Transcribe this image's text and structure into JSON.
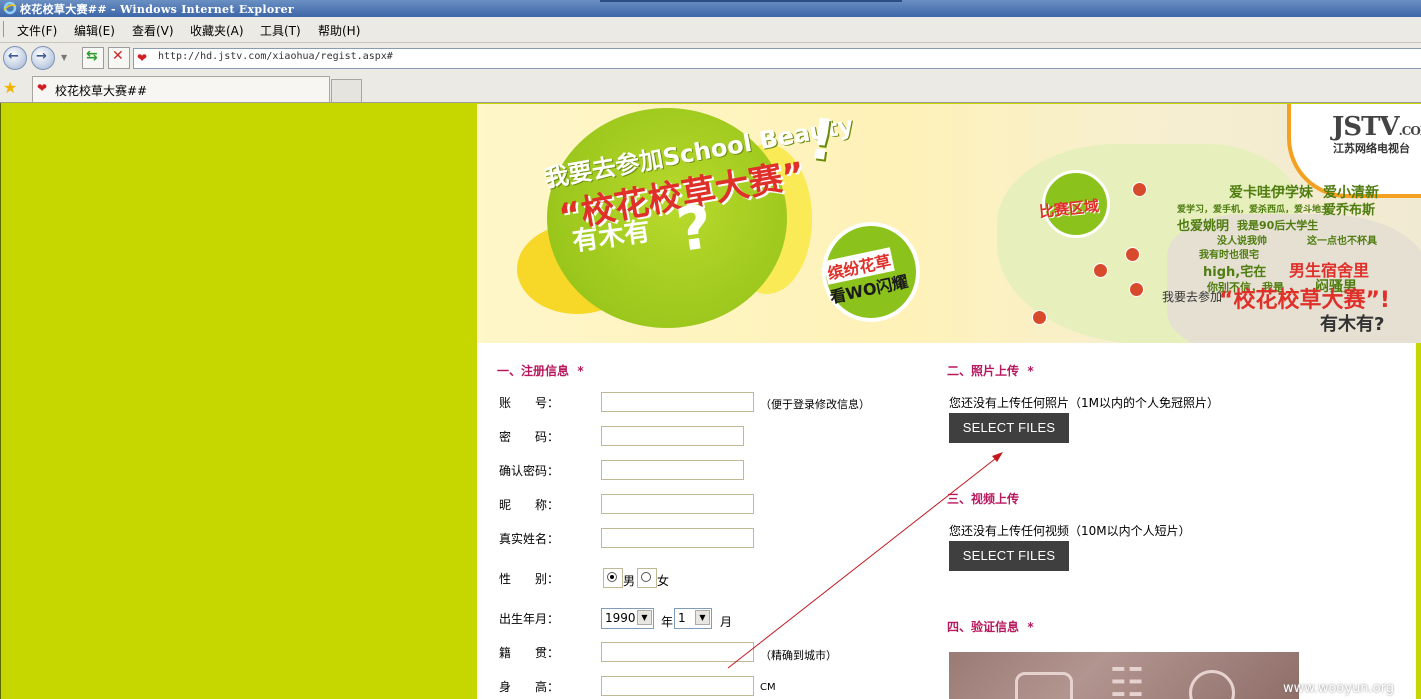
{
  "window": {
    "title": "校花校草大赛## - Windows Internet Explorer"
  },
  "menu": [
    "文件(F)",
    "编辑(E)",
    "查看(V)",
    "收藏夹(A)",
    "工具(T)",
    "帮助(H)"
  ],
  "address": {
    "url": "http://hd.jstv.com/xiaohua/regist.aspx#"
  },
  "tab": {
    "label": "校花校草大赛##"
  },
  "banner": {
    "line1": "我要去参加School Beauty",
    "line2": "“校花校草大赛”",
    "line3": "有木有",
    "question": "?",
    "exclaim": "!",
    "sub1": "缤纷花草",
    "sub2": "看WO闪耀",
    "area": "比赛区域",
    "logo": "JSTV",
    "logo_com": ".COM",
    "logo_sub": "江苏网络电视台",
    "tags": [
      "爱卡哇伊学妹",
      "爱小清新",
      "爱学习，爱手机，爱杀西瓜，爱斗地主",
      "爱乔布斯",
      "也爱姚明",
      "我是90后大学生",
      "没人说我帅",
      "这一点也不杯具",
      "我有时也很宅",
      "high,宅在",
      "男生宿舍里",
      "你别不信，我是",
      "闷骚男"
    ],
    "slogan_prefix": "我要去参加",
    "slogan_main": "“校花校草大赛”!",
    "slogan_end": "有木有?"
  },
  "form": {
    "section1": "一、注册信息",
    "required_mark": "*",
    "fields": [
      {
        "label": "账　　号：",
        "hint": "（便于登录修改信息）"
      },
      {
        "label": "密　　码："
      },
      {
        "label": "确认密码："
      },
      {
        "label": "昵　　称："
      },
      {
        "label": "真实姓名："
      }
    ],
    "gender_label": "性　　别：",
    "gender_male": "男",
    "gender_female": "女",
    "birth_label": "出生年月：",
    "birth_year": "1990",
    "year_unit": "年",
    "birth_month": "1",
    "month_unit": "月",
    "origin_label": "籍　　贯：",
    "origin_hint": "（精确到城市）",
    "height_label": "身　　高：",
    "height_unit": "CM"
  },
  "upload": {
    "section2": "二、照片上传",
    "photo_note": "您还没有上传任何照片（1M以内的个人免冠照片）",
    "select_photo": "SELECT FILES",
    "section3": "三、视频上传",
    "video_note": "您还没有上传任何视频（10M以内个人短片）",
    "select_video": "SELECT FILES",
    "section4": "四、验证信息"
  },
  "watermark": "www.wooyun.org",
  "colors": {
    "page_bg": "#c6d700",
    "section_title": "#b8185d",
    "button_bg": "#3f3f3f",
    "annotation_arrow": "#c2191f"
  }
}
